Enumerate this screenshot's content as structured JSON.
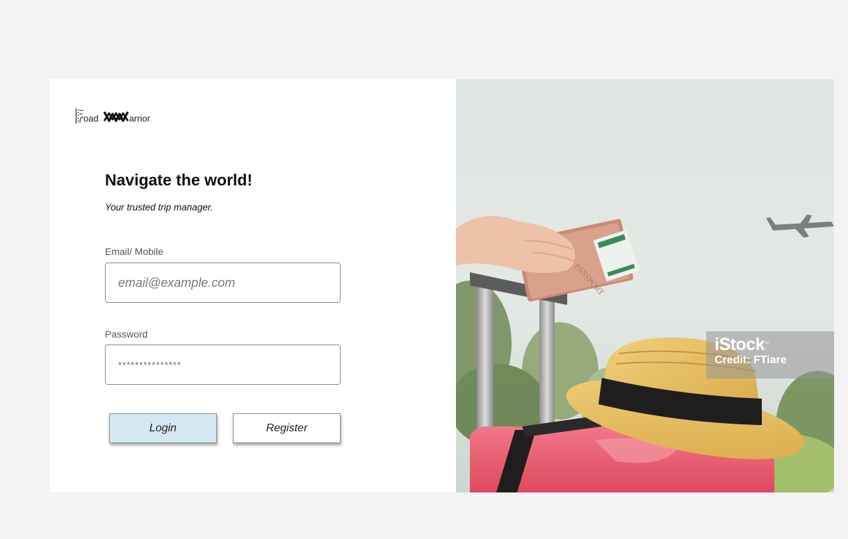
{
  "logo": {
    "text_road": "oad",
    "text_warrior": "arrior"
  },
  "heading": "Navigate the world!",
  "tagline": "Your trusted trip manager.",
  "email": {
    "label": "Email/ Mobile",
    "placeholder": "email@example.com"
  },
  "password": {
    "label": "Password",
    "placeholder": "***************"
  },
  "buttons": {
    "login": "Login",
    "register": "Register"
  },
  "photo": {
    "watermark_brand": "iStock",
    "watermark_tm": "™",
    "watermark_credit": "Credit: FTiare",
    "passport_text": "PASSPORT"
  },
  "colors": {
    "page_bg": "#f3f3f3",
    "card_bg": "#ffffff",
    "login_button_bg": "#d4e7f2",
    "register_button_bg": "#ffffff"
  }
}
